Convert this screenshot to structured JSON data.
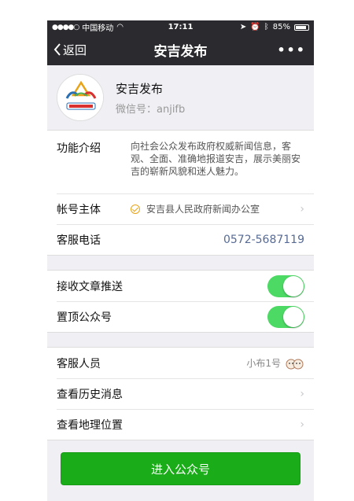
{
  "status": {
    "signal": "●●●●○",
    "carrier": "中国移动",
    "time": "17:11",
    "battery": "85%",
    "battery_level": 0.85
  },
  "nav": {
    "back_label": "返回",
    "title": "安吉发布",
    "more_label": "•••"
  },
  "profile": {
    "name": "安吉发布",
    "wechat_id": "微信号：anjifb"
  },
  "details": {
    "intro_label": "功能介绍",
    "intro_text": "向社会公众发布政府权威新闻信息，客观、全面、准确地报道安吉，展示美丽安吉的崭新风貌和迷人魅力。",
    "owner_label": "帐号主体",
    "owner_value": "安吉县人民政府新闻办公室",
    "phone_label": "客服电话",
    "phone_value": "0572-5687119"
  },
  "settings": {
    "receive_label": "接收文章推送",
    "receive_on": true,
    "pin_label": "置顶公众号",
    "pin_on": true
  },
  "more": {
    "agent_label": "客服人员",
    "agent_value": "小布1号",
    "history_label": "查看历史消息",
    "location_label": "查看地理位置"
  },
  "enter_button": "进入公众号",
  "colors": {
    "bar": "#2b2b2f",
    "toggle": "#4cd964",
    "button": "#1aad19",
    "link": "#576b95"
  }
}
